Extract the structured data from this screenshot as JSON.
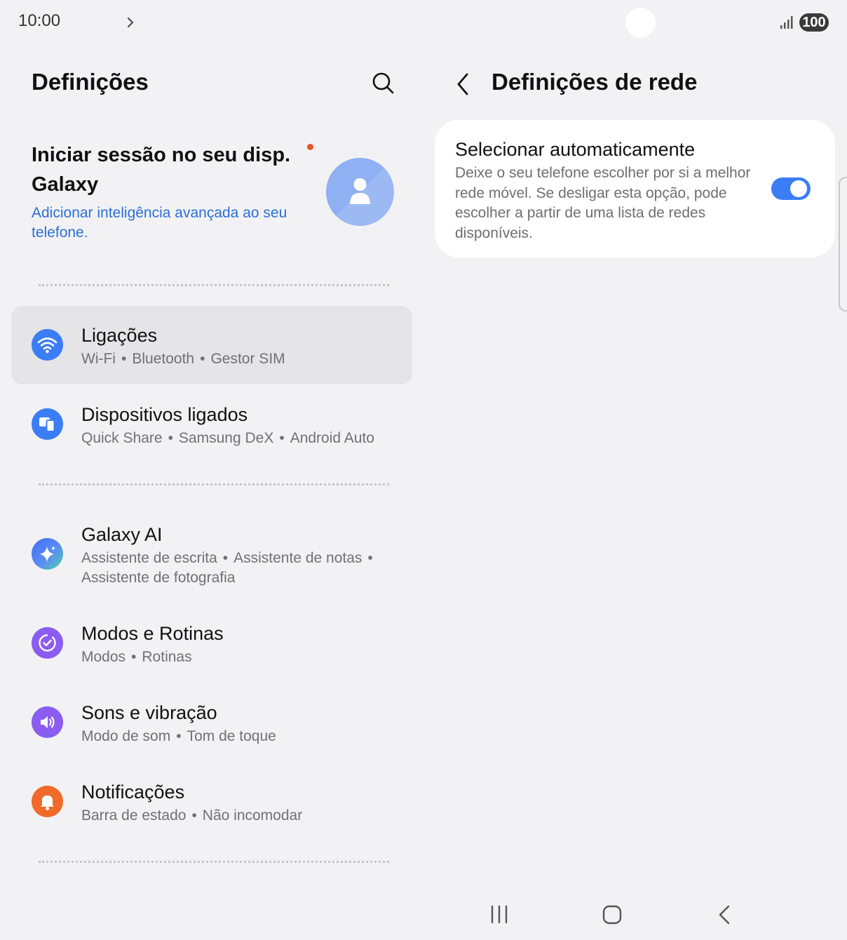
{
  "status_bar": {
    "time": "10:00",
    "battery": "100",
    "icons": [
      "chevron-right-icon",
      "signal-icon"
    ]
  },
  "left_pane": {
    "title": "Definições",
    "search_icon": "search-icon",
    "account": {
      "title": "Iniciar sessão no seu disp. Galaxy",
      "subtitle": "Adicionar inteligência avançada ao seu telefone.",
      "avatar_icon": "person-icon"
    },
    "items": [
      {
        "title": "Ligações",
        "subtitle": [
          "Wi-Fi",
          "Bluetooth",
          "Gestor SIM"
        ],
        "icon": "wifi-icon",
        "color": "#3b7df5",
        "selected": true
      },
      {
        "title": "Dispositivos ligados",
        "subtitle": [
          "Quick Share",
          "Samsung DeX",
          "Android Auto"
        ],
        "icon": "devices-icon",
        "color": "#3b7df5"
      },
      {
        "title": "Galaxy AI",
        "subtitle": [
          "Assistente de escrita",
          "Assistente de notas",
          "Assistente de fotografia"
        ],
        "icon": "sparkle-icon",
        "color": "#4a7cf0"
      },
      {
        "title": "Modos e Rotinas",
        "subtitle": [
          "Modos",
          "Rotinas"
        ],
        "icon": "routine-check-icon",
        "color": "#8a5cf0"
      },
      {
        "title": "Sons e vibração",
        "subtitle": [
          "Modo de som",
          "Tom de toque"
        ],
        "icon": "speaker-icon",
        "color": "#8a5cf0"
      },
      {
        "title": "Notificações",
        "subtitle": [
          "Barra de estado",
          "Não incomodar"
        ],
        "icon": "bell-icon",
        "color": "#f06a2a"
      }
    ]
  },
  "right_pane": {
    "title": "Definições de rede",
    "back_icon": "back-icon",
    "auto_select": {
      "title": "Selecionar automaticamente",
      "description": "Deixe o seu telefone escolher por si a melhor rede móvel. Se desligar esta opção, pode escolher a partir de uma lista de redes disponíveis.",
      "enabled": true,
      "toggle_color": "#3b7df5"
    }
  },
  "nav_bar": {
    "icons": [
      "recent-apps-icon",
      "home-icon",
      "back-nav-icon"
    ]
  },
  "colors": {
    "accent": "#3b7df5",
    "link": "#2a6fd6",
    "badge_dot": "#e8552b"
  }
}
